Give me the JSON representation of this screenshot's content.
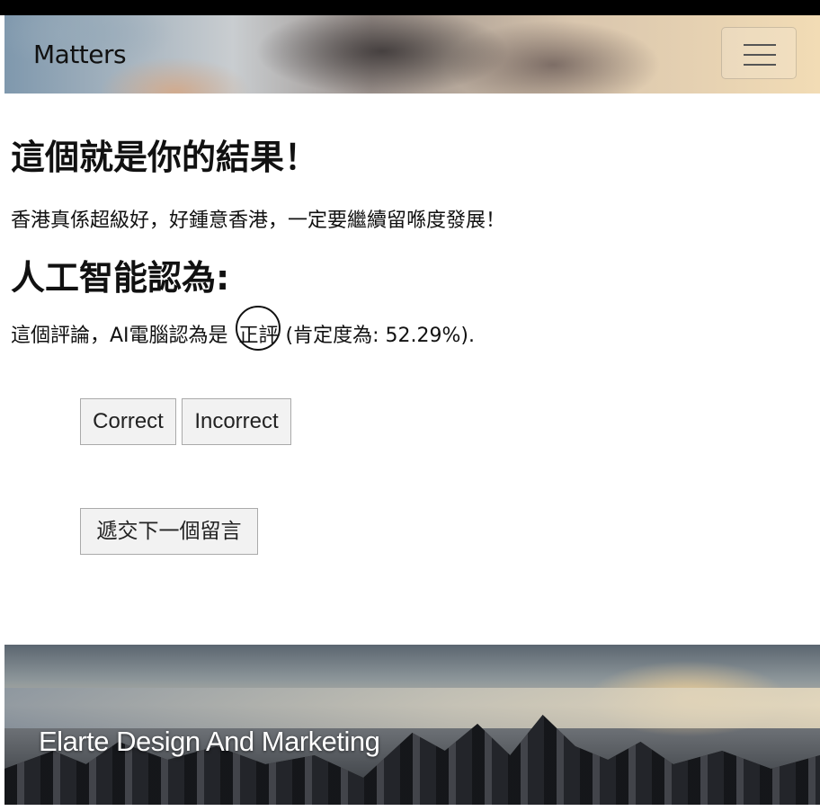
{
  "navbar": {
    "brand": "Matters"
  },
  "result": {
    "heading": "這個就是你的結果！",
    "comment": "香港真係超級好，好鍾意香港，一定要繼續留喺度發展！"
  },
  "ai": {
    "heading": "人工智能認為:",
    "prefix": "這個評論，AI電腦認為是",
    "label": "正評",
    "confidence_text": "(肯定度為: 52.29%)."
  },
  "buttons": {
    "correct": "Correct",
    "incorrect": "Incorrect",
    "next": "遞交下一個留言"
  },
  "footer": {
    "title": "Elarte Design And Marketing"
  }
}
